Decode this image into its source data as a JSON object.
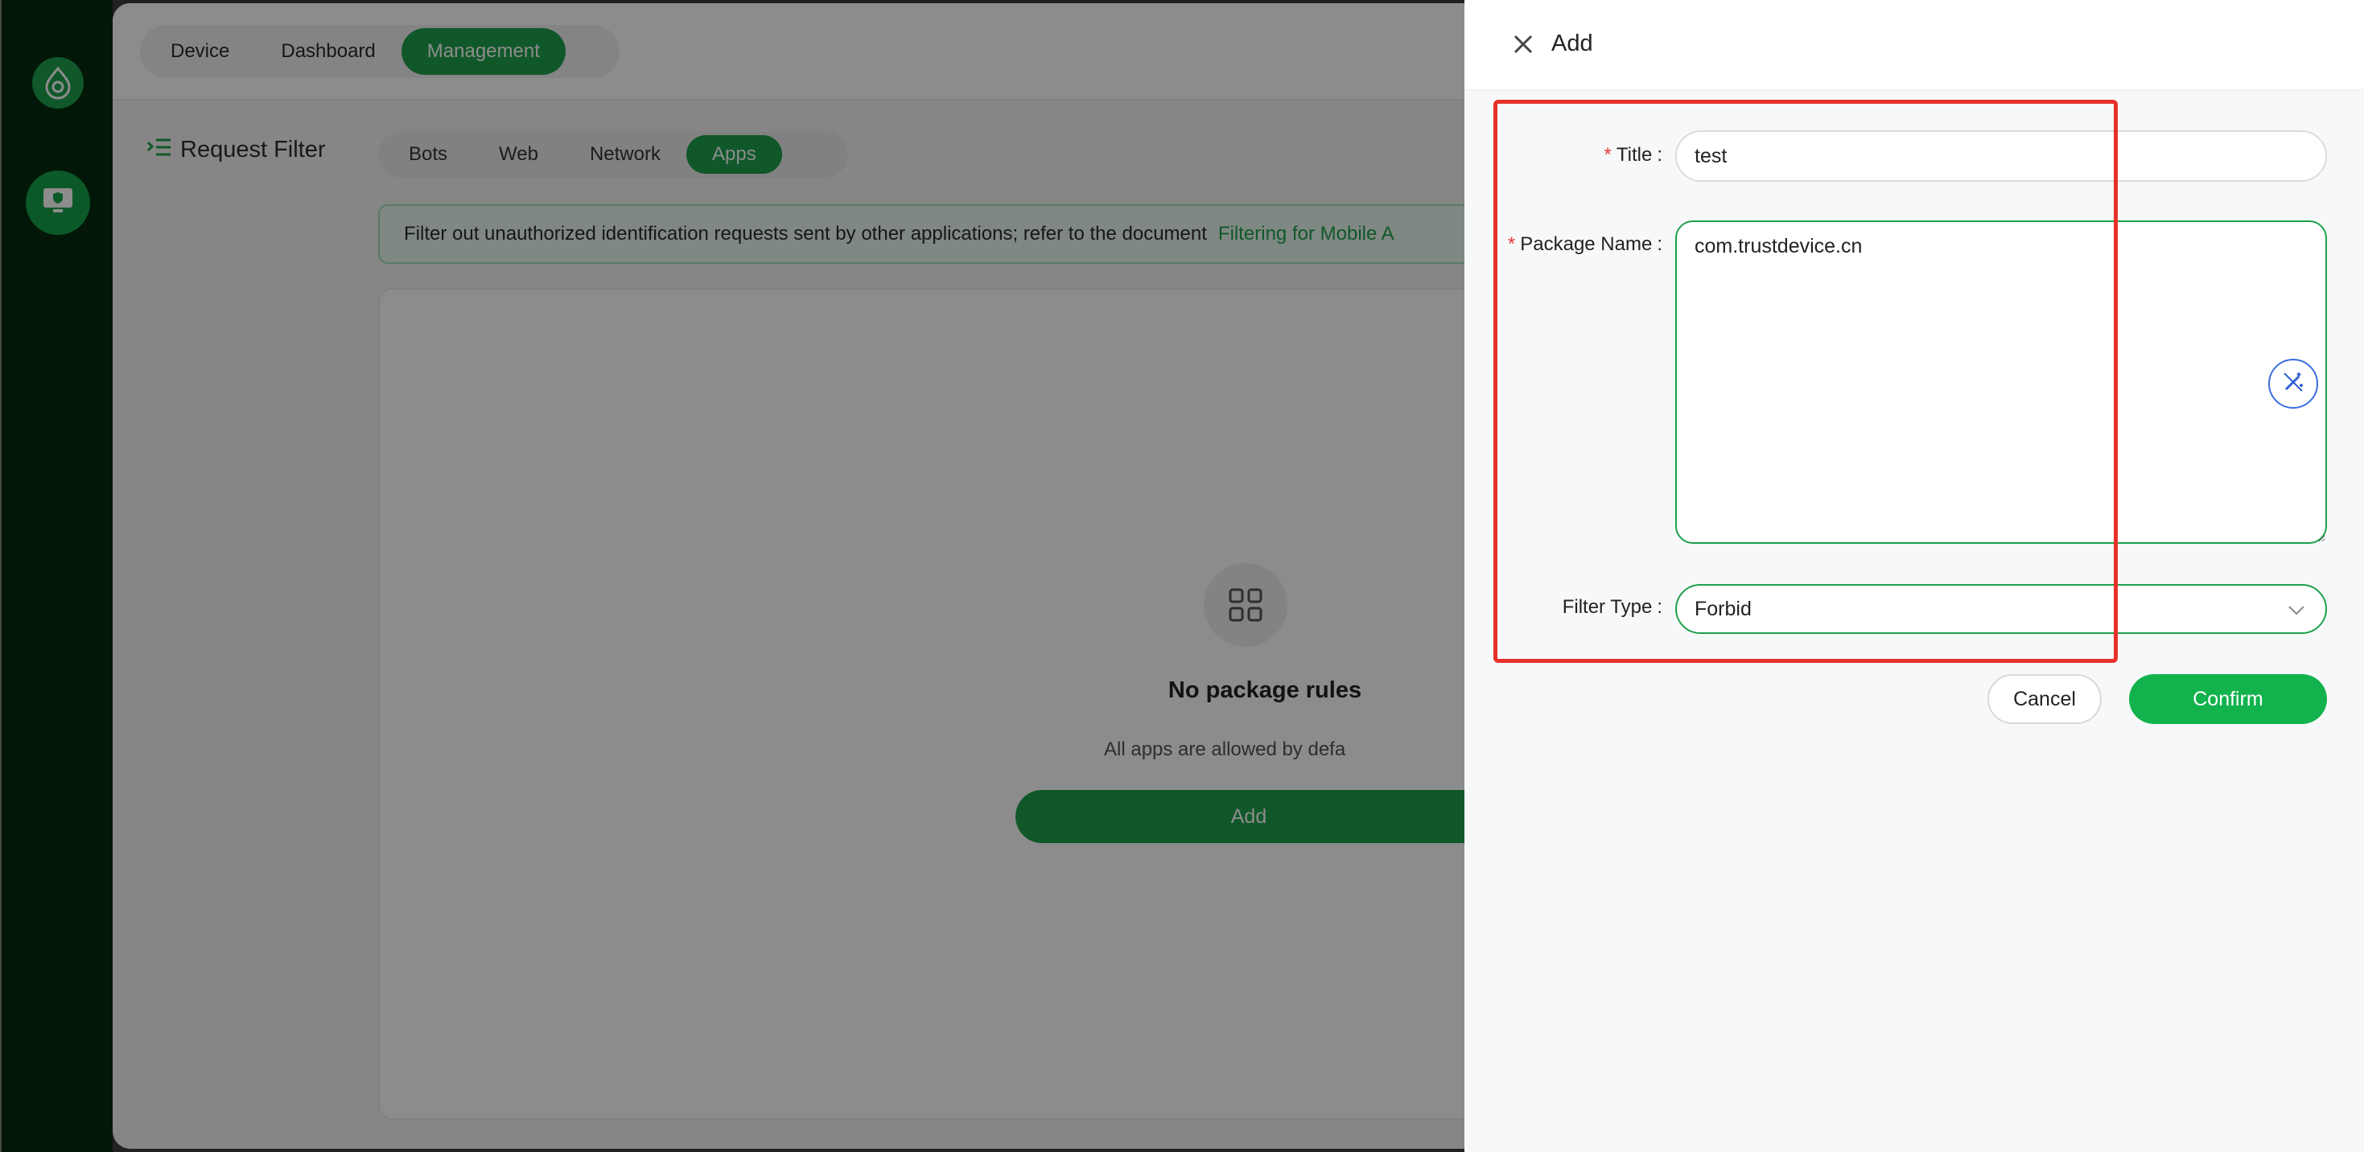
{
  "sidebar": {
    "logo_icon": "app-logo-icon",
    "items": [
      {
        "icon": "monitor-shield-icon",
        "active": true
      }
    ]
  },
  "header": {
    "tabs": [
      {
        "label": "Device",
        "active": false
      },
      {
        "label": "Dashboard",
        "active": false
      },
      {
        "label": "Management",
        "active": true
      }
    ]
  },
  "page": {
    "section_title": "Request Filter",
    "section_icon": "indent-menu-icon",
    "sub_tabs": [
      {
        "label": "Bots",
        "active": false
      },
      {
        "label": "Web",
        "active": false
      },
      {
        "label": "Network",
        "active": false
      },
      {
        "label": "Apps",
        "active": true
      }
    ],
    "notice": {
      "text": "Filter out unauthorized identification requests sent by other applications; refer to the document",
      "link": "Filtering for Mobile A"
    },
    "empty_state": {
      "icon": "apps-grid-icon",
      "title": "No package rules",
      "description": "All apps are allowed by defa",
      "add_label": "Add"
    }
  },
  "drawer": {
    "title": "Add",
    "close_icon": "close-icon",
    "fields": {
      "title": {
        "label": "Title",
        "required": true,
        "value": "test"
      },
      "package_name": {
        "label": "Package Name",
        "required": true,
        "value": "com.trustdevice.cn"
      },
      "filter_type": {
        "label": "Filter Type",
        "required": false,
        "value": "Forbid"
      }
    },
    "colon": ":",
    "required_mark": "*",
    "cancel_label": "Cancel",
    "confirm_label": "Confirm"
  },
  "colors": {
    "brand_green": "#1ea04c",
    "sidebar_bg": "#042a10",
    "highlight_red": "#e6322a",
    "required_red": "#e53935"
  }
}
